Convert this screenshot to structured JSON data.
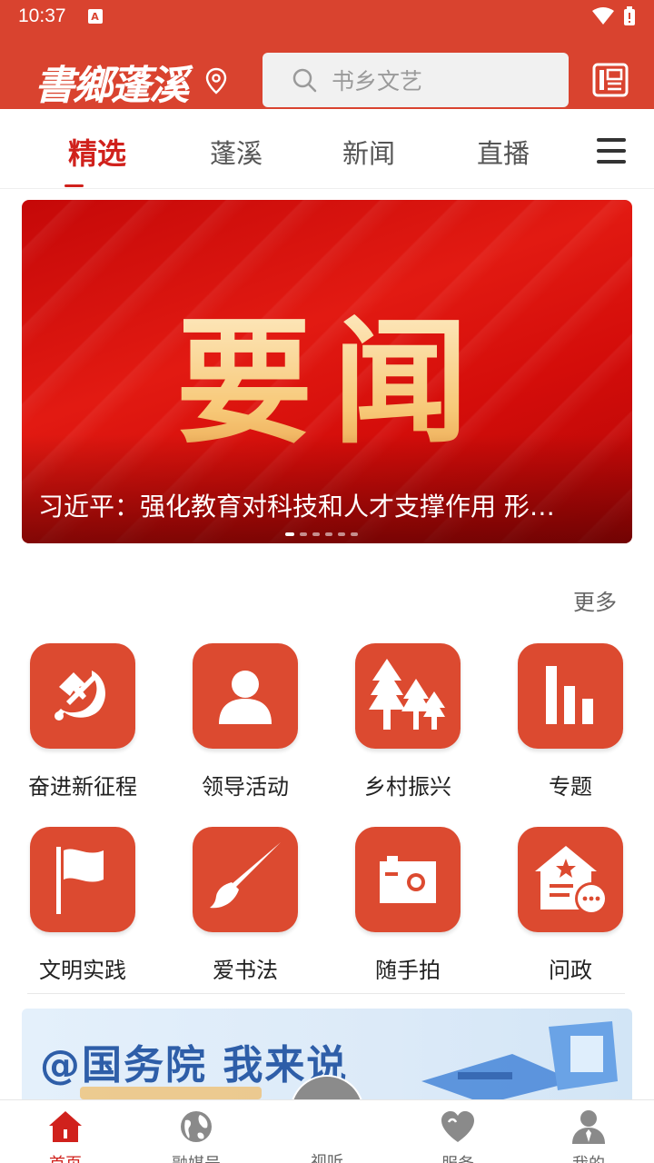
{
  "status_bar": {
    "time": "10:37",
    "notification_badge": "A"
  },
  "header": {
    "logo_text": "書鄉蓬溪",
    "search_placeholder": "书乡文艺"
  },
  "tabs": [
    {
      "label": "精选",
      "active": true
    },
    {
      "label": "蓬溪",
      "active": false
    },
    {
      "label": "新闻",
      "active": false
    },
    {
      "label": "直播",
      "active": false
    }
  ],
  "banner": {
    "headline": "要闻",
    "caption": "习近平：强化教育对科技和人才支撑作用 形…",
    "slide_count": 6,
    "active_slide": 1
  },
  "section": {
    "more_label": "更多"
  },
  "grid": [
    {
      "label": "奋进新征程",
      "icon": "party-emblem-icon"
    },
    {
      "label": "领导活动",
      "icon": "person-icon"
    },
    {
      "label": "乡村振兴",
      "icon": "trees-icon"
    },
    {
      "label": "专题",
      "icon": "bar-chart-icon"
    },
    {
      "label": "文明实践",
      "icon": "flag-icon"
    },
    {
      "label": "爱书法",
      "icon": "brush-icon"
    },
    {
      "label": "随手拍",
      "icon": "camera-icon"
    },
    {
      "label": "问政",
      "icon": "house-chat-icon"
    }
  ],
  "promo": {
    "text": "@国务院 我来说"
  },
  "bottom_nav": [
    {
      "label": "首页",
      "icon": "home-icon",
      "active": true
    },
    {
      "label": "融媒号",
      "icon": "globe-icon",
      "active": false
    },
    {
      "label": "视听",
      "icon": "video-icon",
      "active": false
    },
    {
      "label": "服务",
      "icon": "heart-icon",
      "active": false
    },
    {
      "label": "我的",
      "icon": "user-icon",
      "active": false
    }
  ],
  "colors": {
    "brand_red": "#d9432f",
    "active_tab": "#d0211c",
    "icon_tile": "#dc4a30"
  }
}
